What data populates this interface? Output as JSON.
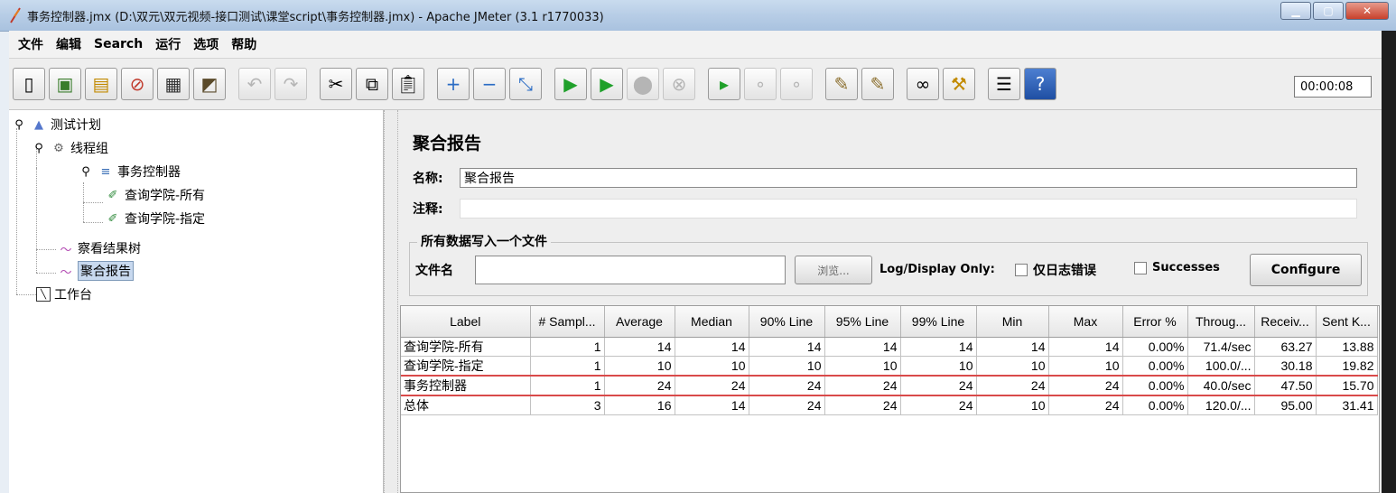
{
  "window": {
    "title": "事务控制器.jmx (D:\\双元\\双元视频-接口测试\\课堂script\\事务控制器.jmx) - Apache JMeter (3.1 r1770033)"
  },
  "menu": [
    "文件",
    "编辑",
    "Search",
    "运行",
    "选项",
    "帮助"
  ],
  "toolbar": {
    "timer": "00:00:08"
  },
  "tree": {
    "test_plan": "测试计划",
    "thread_group": "线程组",
    "transaction_controller": "事务控制器",
    "sampler_all": "查询学院-所有",
    "sampler_specific": "查询学院-指定",
    "view_results_tree": "察看结果树",
    "aggregate_report": "聚合报告",
    "workbench": "工作台"
  },
  "panel": {
    "title": "聚合报告",
    "name_label": "名称:",
    "name_value": "聚合报告",
    "comment_label": "注释:",
    "comment_value": "",
    "group_title": "所有数据写入一个文件",
    "filename_label": "文件名",
    "filename_value": "",
    "browse_label": "浏览...",
    "log_display_label": "Log/Display Only:",
    "errors_only_label": "仅日志错误",
    "successes_label": "Successes",
    "configure_label": "Configure"
  },
  "table": {
    "headers": [
      "Label",
      "# Sampl...",
      "Average",
      "Median",
      "90% Line",
      "95% Line",
      "99% Line",
      "Min",
      "Max",
      "Error %",
      "Throug...",
      "Receiv...",
      "Sent K..."
    ],
    "rows": [
      [
        "查询学院-所有",
        "1",
        "14",
        "14",
        "14",
        "14",
        "14",
        "14",
        "14",
        "0.00%",
        "71.4/sec",
        "63.27",
        "13.88"
      ],
      [
        "查询学院-指定",
        "1",
        "10",
        "10",
        "10",
        "10",
        "10",
        "10",
        "10",
        "0.00%",
        "100.0/...",
        "30.18",
        "19.82"
      ],
      [
        "事务控制器",
        "1",
        "24",
        "24",
        "24",
        "24",
        "24",
        "24",
        "24",
        "0.00%",
        "40.0/sec",
        "47.50",
        "15.70"
      ],
      [
        "总体",
        "3",
        "16",
        "14",
        "24",
        "24",
        "24",
        "10",
        "24",
        "0.00%",
        "120.0/...",
        "95.00",
        "31.41"
      ]
    ],
    "highlighted_row": 2
  }
}
